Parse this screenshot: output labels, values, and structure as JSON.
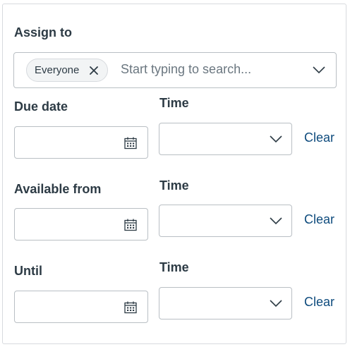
{
  "assign": {
    "label": "Assign to",
    "chip": "Everyone",
    "chip_remove_icon": "close-icon",
    "placeholder": "Start typing to search...",
    "dropdown_icon": "chevron-down-icon"
  },
  "due": {
    "label": "Due date",
    "time_label": "Time",
    "clear": "Clear",
    "date_value": "",
    "time_value": ""
  },
  "available": {
    "label": "Available from",
    "time_label": "Time",
    "clear": "Clear",
    "date_value": "",
    "time_value": ""
  },
  "until": {
    "label": "Until",
    "time_label": "Time",
    "clear": "Clear",
    "date_value": "",
    "time_value": ""
  },
  "icons": {
    "date_picker": "calendar-icon",
    "time_dropdown": "chevron-down-icon"
  },
  "colors": {
    "link": "#0e4b7d",
    "text": "#2d3b45",
    "border": "#b9bfc4",
    "placeholder": "#6b7780"
  }
}
